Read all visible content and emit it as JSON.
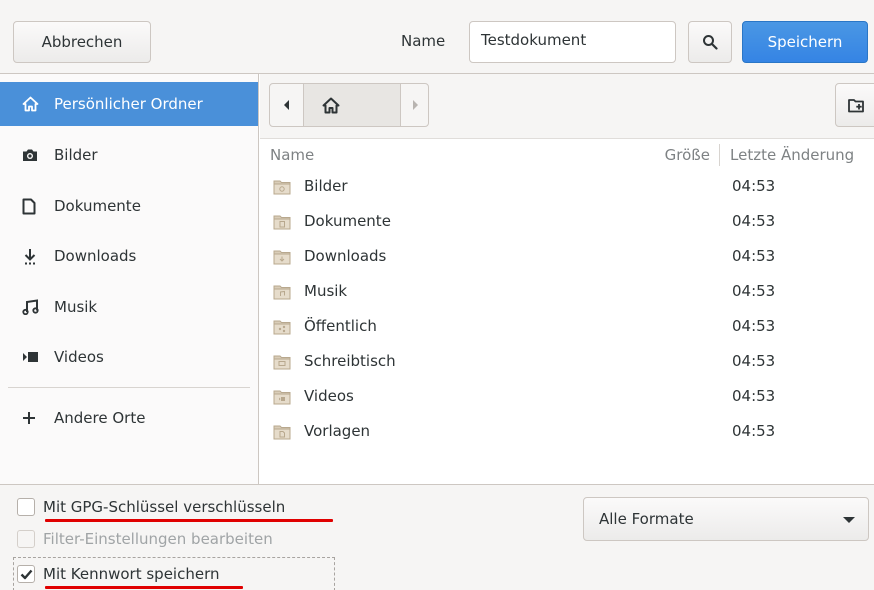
{
  "header": {
    "cancel_label": "Abbrechen",
    "name_label": "Name",
    "name_value": "Testdokument",
    "save_label": "Speichern"
  },
  "sidebar": {
    "items": [
      {
        "label": "Persönlicher Ordner",
        "icon": "home-icon",
        "active": true
      },
      {
        "label": "Bilder",
        "icon": "camera-icon"
      },
      {
        "label": "Dokumente",
        "icon": "document-icon"
      },
      {
        "label": "Downloads",
        "icon": "download-icon"
      },
      {
        "label": "Musik",
        "icon": "music-icon"
      },
      {
        "label": "Videos",
        "icon": "video-icon"
      },
      {
        "label": "Andere Orte",
        "icon": "plus-icon"
      }
    ]
  },
  "pathbar": {
    "current": "home-icon"
  },
  "columns": {
    "name": "Name",
    "size": "Größe",
    "modified": "Letzte Änderung"
  },
  "files": [
    {
      "name": "Bilder",
      "modified": "04:53"
    },
    {
      "name": "Dokumente",
      "modified": "04:53"
    },
    {
      "name": "Downloads",
      "modified": "04:53"
    },
    {
      "name": "Musik",
      "modified": "04:53"
    },
    {
      "name": "Öffentlich",
      "modified": "04:53"
    },
    {
      "name": "Schreibtisch",
      "modified": "04:53"
    },
    {
      "name": "Videos",
      "modified": "04:53"
    },
    {
      "name": "Vorlagen",
      "modified": "04:53"
    }
  ],
  "footer": {
    "gpg_label": "Mit GPG-Schlüssel verschlüsseln",
    "gpg_checked": false,
    "filter_label": "Filter-Einstellungen bearbeiten",
    "filter_enabled": false,
    "password_label": "Mit Kennwort speichern",
    "password_checked": true,
    "format_value": "Alle Formate"
  },
  "colors": {
    "accent": "#3584e4",
    "sidebar_selected": "#4a90d9",
    "annotation_underline": "#e00000",
    "folder": "#d9cdb8"
  }
}
